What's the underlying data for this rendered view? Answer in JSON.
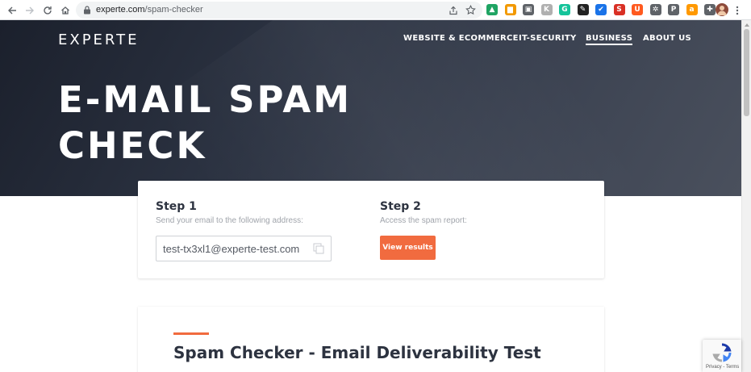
{
  "browser": {
    "url_domain": "experte.com",
    "url_path": "/spam-checker",
    "extensions": [
      {
        "icon": "google-drive-icon",
        "color": "#1fa463",
        "glyph": "▲"
      },
      {
        "icon": "slides-folder-icon",
        "color": "#f29900",
        "glyph": "▆"
      },
      {
        "icon": "reader-icon",
        "color": "#5f6368",
        "glyph": "▣"
      },
      {
        "icon": "k-icon",
        "color": "#b0b0b0",
        "glyph": "K"
      },
      {
        "icon": "grammarly-icon",
        "color": "#15c39a",
        "glyph": "G"
      },
      {
        "icon": "clipper-icon",
        "color": "#222222",
        "glyph": "✎"
      },
      {
        "icon": "check-icon",
        "color": "#1a73e8",
        "glyph": "✔"
      },
      {
        "icon": "s-icon",
        "color": "#d93025",
        "glyph": "S"
      },
      {
        "icon": "u-icon",
        "color": "#ff5a1f",
        "glyph": "U"
      },
      {
        "icon": "gear-extension-icon",
        "color": "#5f6368",
        "glyph": "✲"
      },
      {
        "icon": "pinterest-icon",
        "color": "#5f6368",
        "glyph": "P"
      },
      {
        "icon": "amazon-icon",
        "color": "#ff9900",
        "glyph": "a"
      },
      {
        "icon": "puzzle-icon",
        "color": "#5f6368",
        "glyph": "✚"
      }
    ]
  },
  "header": {
    "logo": "EXPERTE",
    "nav": [
      {
        "label": "WEBSITE & ECOMMERCE"
      },
      {
        "label": "IT-SECURITY"
      },
      {
        "label": "BUSINESS"
      },
      {
        "label": "ABOUT US"
      }
    ],
    "active_nav": "BUSINESS"
  },
  "hero": {
    "title_line1": "E-MAIL SPAM",
    "title_line2": "CHECK"
  },
  "steps": {
    "step1": {
      "title": "Step 1",
      "subtitle": "Send your email to the following address:",
      "email": "test-tx3xl1@experte-test.com"
    },
    "step2": {
      "title": "Step 2",
      "subtitle": "Access the spam report:",
      "button_label": "View results"
    }
  },
  "content": {
    "heading": "Spam Checker - Email Deliverability Test"
  },
  "recaptcha": {
    "links": "Privacy - Terms"
  },
  "colors": {
    "accent": "#f16b3f",
    "hero_dark": "#1b202c",
    "text_dark": "#2d3340"
  }
}
